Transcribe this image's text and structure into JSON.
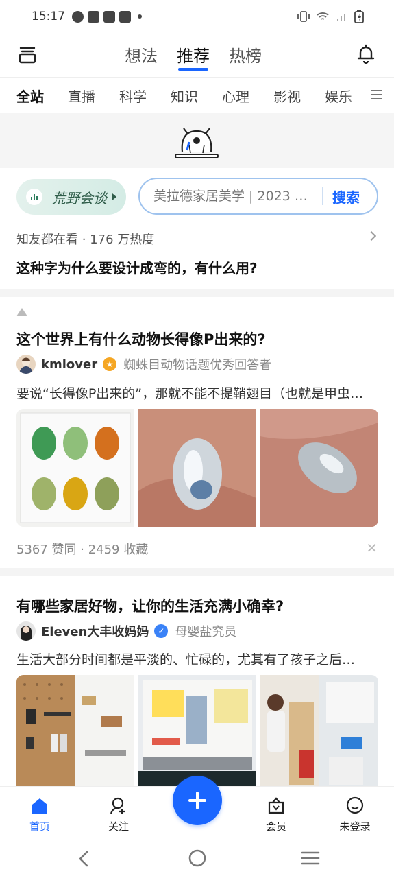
{
  "status": {
    "time": "15:17"
  },
  "top_tabs": [
    "想法",
    "推荐",
    "热榜"
  ],
  "categories": [
    "全站",
    "直播",
    "科学",
    "知识",
    "心理",
    "影视",
    "娱乐"
  ],
  "promo": {
    "badge_text": "荒野会谈",
    "search_placeholder": "美拉德家居美学 | 2023 …",
    "search_button": "搜索"
  },
  "hot": {
    "meta": "知友都在看 · 176 万热度",
    "title": "这种字为什么要设计成弯的，有什么用?"
  },
  "cards": [
    {
      "title": "这个世界上有什么动物长得像P出来的?",
      "author": "kmlover",
      "author_desc": "蜘蛛目动物话题优秀回答者",
      "excerpt": "要说“长得像P出来的”，那就不能不提鞘翅目（也就是甲虫…",
      "stats": "5367 赞同 · 2459 收藏"
    },
    {
      "title": "有哪些家居好物，让你的生活充满小确幸?",
      "author": "Eleven大丰收妈妈",
      "author_desc": "母婴盐究员",
      "excerpt": "生活大部分时间都是平淡的、忙碌的，尤其有了孩子之后…"
    }
  ],
  "bottom_nav": {
    "home": "首页",
    "follow": "关注",
    "member": "会员",
    "profile": "未登录"
  },
  "colors": {
    "accent": "#1a66ff",
    "badge": "#f5a623"
  }
}
